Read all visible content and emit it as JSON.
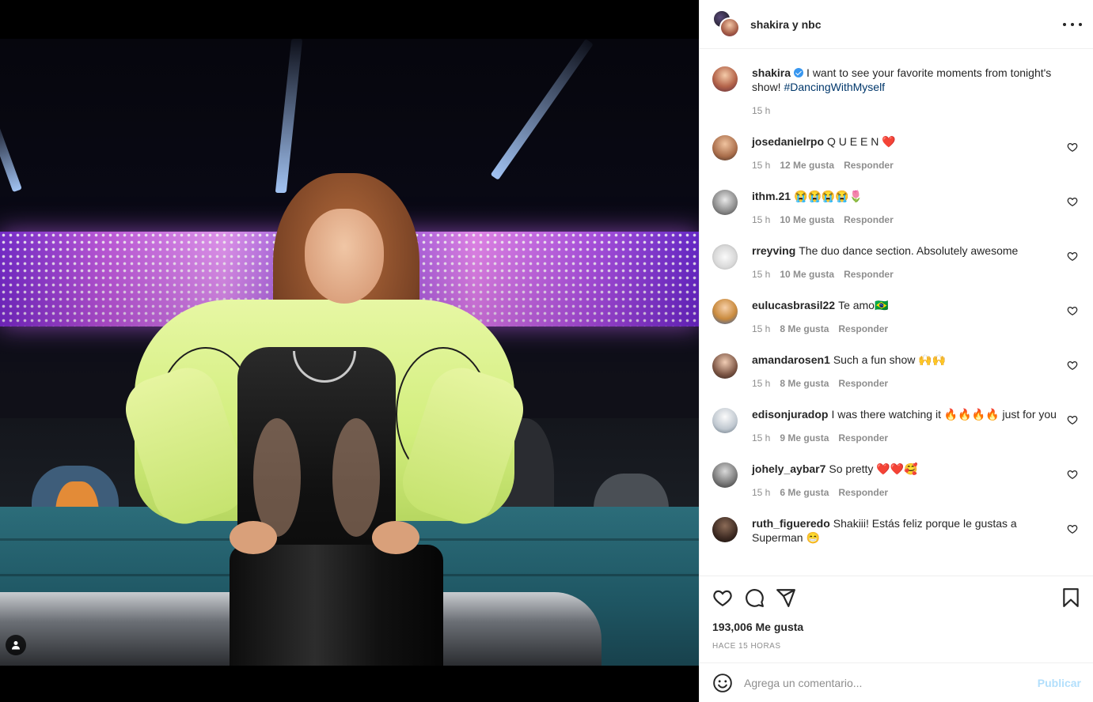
{
  "header": {
    "account": "shakira y nbc",
    "more_icon": "more-horizontal-icon"
  },
  "caption": {
    "user": "shakira",
    "verified": true,
    "text": "I want to see your favorite moments from tonight's show!",
    "hashtag": "#DancingWithMyself",
    "time": "15 h"
  },
  "comments": [
    {
      "user": "josedanielrpo",
      "text": "Q U E E N ❤️",
      "time": "15 h",
      "likes": "12 Me gusta",
      "reply": "Responder"
    },
    {
      "user": "ithm.21",
      "text": "😭😭😭😭🌷",
      "time": "15 h",
      "likes": "10 Me gusta",
      "reply": "Responder"
    },
    {
      "user": "rreyving",
      "text": "The duo dance section. Absolutely awesome",
      "time": "15 h",
      "likes": "10 Me gusta",
      "reply": "Responder"
    },
    {
      "user": "eulucasbrasil22",
      "text": "Te amo🇧🇷",
      "time": "15 h",
      "likes": "8 Me gusta",
      "reply": "Responder"
    },
    {
      "user": "amandarosen1",
      "text": "Such a fun show 🙌🙌",
      "time": "15 h",
      "likes": "8 Me gusta",
      "reply": "Responder"
    },
    {
      "user": "edisonjuradop",
      "text": "I was there watching it 🔥🔥🔥🔥 just for you",
      "time": "15 h",
      "likes": "9 Me gusta",
      "reply": "Responder"
    },
    {
      "user": "johely_aybar7",
      "text": "So pretty ❤️❤️🥰",
      "time": "15 h",
      "likes": "6 Me gusta",
      "reply": "Responder"
    },
    {
      "user": "ruth_figueredo",
      "text": "Shakiii! Estás feliz porque le gustas a Superman 😁",
      "time": "",
      "likes": "",
      "reply": ""
    }
  ],
  "actions": {
    "likes": "193,006 Me gusta",
    "time_ago": "HACE 15 HORAS",
    "icons": [
      "heart-icon",
      "comment-icon",
      "share-icon",
      "bookmark-icon"
    ]
  },
  "add_comment": {
    "placeholder": "Agrega un comentario...",
    "publish_label": "Publicar"
  },
  "colors": {
    "link": "#00376b",
    "muted": "#8e8e8e",
    "publish": "#b2dffc",
    "verified": "#3897f0"
  }
}
